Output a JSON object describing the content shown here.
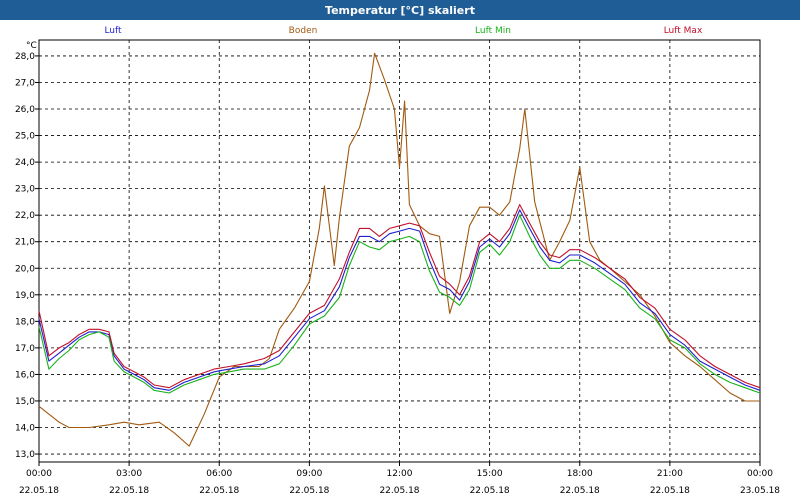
{
  "window": {
    "title": "Temperatur [°C] skaliert"
  },
  "colors": {
    "title_bar": "#1f5d96",
    "luft": "#1f1fd0",
    "boden": "#a05a10",
    "luft_min": "#19b219",
    "luft_max": "#c0102a"
  },
  "chart_data": {
    "type": "line",
    "title": "Temperatur [°C] skaliert",
    "xlabel": "",
    "ylabel": "°C",
    "y_unit_label": "°C",
    "ylim": [
      12.7,
      28.6
    ],
    "y_ticks": [
      "13,0",
      "14,0",
      "15,0",
      "16,0",
      "17,0",
      "18,0",
      "19,0",
      "20,0",
      "21,0",
      "22,0",
      "23,0",
      "24,0",
      "25,0",
      "26,0",
      "27,0",
      "28,0"
    ],
    "x_hours_range": [
      0,
      24
    ],
    "x_ticks": [
      {
        "time": "00:00",
        "date": "22.05.18"
      },
      {
        "time": "03:00",
        "date": "22.05.18"
      },
      {
        "time": "06:00",
        "date": "22.05.18"
      },
      {
        "time": "09:00",
        "date": "22.05.18"
      },
      {
        "time": "12:00",
        "date": "22.05.18"
      },
      {
        "time": "15:00",
        "date": "22.05.18"
      },
      {
        "time": "18:00",
        "date": "22.05.18"
      },
      {
        "time": "21:00",
        "date": "22.05.18"
      },
      {
        "time": "00:00",
        "date": "23.05.18"
      }
    ],
    "grid": true,
    "legend_position": "top",
    "series": [
      {
        "name": "Luft",
        "color": "#1f1fd0",
        "points": [
          [
            0,
            18.1
          ],
          [
            0.33,
            16.5
          ],
          [
            0.67,
            16.8
          ],
          [
            1.0,
            17.1
          ],
          [
            1.33,
            17.4
          ],
          [
            1.67,
            17.6
          ],
          [
            2.0,
            17.6
          ],
          [
            2.33,
            17.5
          ],
          [
            2.5,
            16.7
          ],
          [
            2.83,
            16.2
          ],
          [
            3.17,
            16.0
          ],
          [
            3.5,
            15.8
          ],
          [
            3.83,
            15.5
          ],
          [
            4.33,
            15.4
          ],
          [
            4.83,
            15.7
          ],
          [
            5.33,
            15.9
          ],
          [
            5.83,
            16.1
          ],
          [
            6.33,
            16.2
          ],
          [
            6.83,
            16.3
          ],
          [
            7.5,
            16.4
          ],
          [
            8.0,
            16.7
          ],
          [
            8.5,
            17.4
          ],
          [
            9.0,
            18.1
          ],
          [
            9.5,
            18.4
          ],
          [
            10.0,
            19.3
          ],
          [
            10.33,
            20.4
          ],
          [
            10.67,
            21.2
          ],
          [
            11.0,
            21.2
          ],
          [
            11.33,
            21.0
          ],
          [
            11.67,
            21.3
          ],
          [
            12.0,
            21.4
          ],
          [
            12.33,
            21.5
          ],
          [
            12.67,
            21.4
          ],
          [
            13.0,
            20.3
          ],
          [
            13.33,
            19.4
          ],
          [
            13.67,
            19.2
          ],
          [
            14.0,
            18.8
          ],
          [
            14.33,
            19.5
          ],
          [
            14.67,
            20.8
          ],
          [
            15.0,
            21.1
          ],
          [
            15.33,
            20.8
          ],
          [
            15.67,
            21.3
          ],
          [
            16.0,
            22.2
          ],
          [
            16.33,
            21.5
          ],
          [
            16.67,
            20.8
          ],
          [
            17.0,
            20.3
          ],
          [
            17.33,
            20.2
          ],
          [
            17.67,
            20.5
          ],
          [
            18.0,
            20.5
          ],
          [
            18.5,
            20.2
          ],
          [
            19.0,
            19.8
          ],
          [
            19.5,
            19.4
          ],
          [
            20.0,
            18.7
          ],
          [
            20.5,
            18.3
          ],
          [
            21.0,
            17.5
          ],
          [
            21.5,
            17.1
          ],
          [
            22.0,
            16.5
          ],
          [
            22.5,
            16.2
          ],
          [
            23.0,
            15.9
          ],
          [
            23.5,
            15.6
          ],
          [
            24.0,
            15.4
          ]
        ]
      },
      {
        "name": "Boden",
        "color": "#a05a10",
        "points": [
          [
            0,
            14.8
          ],
          [
            0.67,
            14.2
          ],
          [
            1.0,
            14.0
          ],
          [
            1.67,
            14.0
          ],
          [
            2.33,
            14.1
          ],
          [
            2.83,
            14.2
          ],
          [
            3.33,
            14.1
          ],
          [
            4.0,
            14.2
          ],
          [
            4.5,
            13.8
          ],
          [
            5.0,
            13.3
          ],
          [
            5.5,
            14.5
          ],
          [
            6.0,
            15.9
          ],
          [
            6.5,
            16.3
          ],
          [
            7.0,
            16.3
          ],
          [
            7.33,
            16.3
          ],
          [
            7.67,
            16.6
          ],
          [
            8.0,
            17.7
          ],
          [
            8.5,
            18.5
          ],
          [
            9.0,
            19.5
          ],
          [
            9.33,
            21.5
          ],
          [
            9.5,
            23.1
          ],
          [
            9.83,
            20.1
          ],
          [
            10.0,
            21.9
          ],
          [
            10.33,
            24.6
          ],
          [
            10.67,
            25.3
          ],
          [
            11.0,
            26.7
          ],
          [
            11.17,
            28.1
          ],
          [
            11.5,
            27.1
          ],
          [
            11.83,
            26.0
          ],
          [
            12.0,
            23.8
          ],
          [
            12.17,
            26.3
          ],
          [
            12.33,
            22.4
          ],
          [
            12.67,
            21.6
          ],
          [
            13.0,
            21.3
          ],
          [
            13.33,
            21.2
          ],
          [
            13.67,
            18.3
          ],
          [
            14.0,
            19.5
          ],
          [
            14.33,
            21.6
          ],
          [
            14.67,
            22.3
          ],
          [
            15.0,
            22.3
          ],
          [
            15.33,
            22.0
          ],
          [
            15.67,
            22.5
          ],
          [
            16.0,
            24.5
          ],
          [
            16.17,
            26.0
          ],
          [
            16.5,
            22.5
          ],
          [
            17.0,
            20.3
          ],
          [
            17.33,
            21.0
          ],
          [
            17.67,
            21.8
          ],
          [
            18.0,
            23.8
          ],
          [
            18.33,
            21.0
          ],
          [
            18.67,
            20.3
          ],
          [
            19.0,
            20.0
          ],
          [
            19.5,
            19.5
          ],
          [
            20.0,
            19.0
          ],
          [
            20.5,
            18.2
          ],
          [
            21.0,
            17.2
          ],
          [
            21.5,
            16.7
          ],
          [
            22.0,
            16.3
          ],
          [
            22.5,
            15.8
          ],
          [
            23.0,
            15.3
          ],
          [
            23.5,
            15.0
          ],
          [
            24.0,
            15.0
          ]
        ]
      },
      {
        "name": "Luft Min",
        "color": "#19b219",
        "points": [
          [
            0,
            17.8
          ],
          [
            0.33,
            16.2
          ],
          [
            0.67,
            16.6
          ],
          [
            1.0,
            16.9
          ],
          [
            1.33,
            17.3
          ],
          [
            1.67,
            17.5
          ],
          [
            2.0,
            17.6
          ],
          [
            2.33,
            17.4
          ],
          [
            2.5,
            16.5
          ],
          [
            2.83,
            16.1
          ],
          [
            3.17,
            15.9
          ],
          [
            3.5,
            15.7
          ],
          [
            3.83,
            15.4
          ],
          [
            4.33,
            15.3
          ],
          [
            4.83,
            15.6
          ],
          [
            5.33,
            15.8
          ],
          [
            5.83,
            16.0
          ],
          [
            6.33,
            16.1
          ],
          [
            6.83,
            16.2
          ],
          [
            7.5,
            16.2
          ],
          [
            8.0,
            16.4
          ],
          [
            8.5,
            17.1
          ],
          [
            9.0,
            17.9
          ],
          [
            9.5,
            18.2
          ],
          [
            10.0,
            18.9
          ],
          [
            10.33,
            20.1
          ],
          [
            10.67,
            21.0
          ],
          [
            11.0,
            20.8
          ],
          [
            11.33,
            20.7
          ],
          [
            11.67,
            21.0
          ],
          [
            12.0,
            21.1
          ],
          [
            12.33,
            21.2
          ],
          [
            12.67,
            21.0
          ],
          [
            13.0,
            19.9
          ],
          [
            13.33,
            19.1
          ],
          [
            13.67,
            18.9
          ],
          [
            14.0,
            18.6
          ],
          [
            14.33,
            19.2
          ],
          [
            14.67,
            20.6
          ],
          [
            15.0,
            20.9
          ],
          [
            15.33,
            20.5
          ],
          [
            15.67,
            21.0
          ],
          [
            16.0,
            22.0
          ],
          [
            16.33,
            21.2
          ],
          [
            16.67,
            20.5
          ],
          [
            17.0,
            20.0
          ],
          [
            17.33,
            20.0
          ],
          [
            17.67,
            20.3
          ],
          [
            18.0,
            20.3
          ],
          [
            18.5,
            20.0
          ],
          [
            19.0,
            19.6
          ],
          [
            19.5,
            19.2
          ],
          [
            20.0,
            18.5
          ],
          [
            20.5,
            18.1
          ],
          [
            21.0,
            17.3
          ],
          [
            21.5,
            17.0
          ],
          [
            22.0,
            16.4
          ],
          [
            22.5,
            16.0
          ],
          [
            23.0,
            15.7
          ],
          [
            23.5,
            15.5
          ],
          [
            24.0,
            15.3
          ]
        ]
      },
      {
        "name": "Luft Max",
        "color": "#c0102a",
        "points": [
          [
            0,
            18.4
          ],
          [
            0.33,
            16.7
          ],
          [
            0.67,
            17.0
          ],
          [
            1.0,
            17.2
          ],
          [
            1.33,
            17.5
          ],
          [
            1.67,
            17.7
          ],
          [
            2.0,
            17.7
          ],
          [
            2.33,
            17.6
          ],
          [
            2.5,
            16.8
          ],
          [
            2.83,
            16.3
          ],
          [
            3.17,
            16.1
          ],
          [
            3.5,
            15.9
          ],
          [
            3.83,
            15.6
          ],
          [
            4.33,
            15.5
          ],
          [
            4.83,
            15.8
          ],
          [
            5.33,
            16.0
          ],
          [
            5.83,
            16.2
          ],
          [
            6.33,
            16.3
          ],
          [
            6.83,
            16.4
          ],
          [
            7.5,
            16.6
          ],
          [
            8.0,
            16.9
          ],
          [
            8.5,
            17.6
          ],
          [
            9.0,
            18.3
          ],
          [
            9.5,
            18.6
          ],
          [
            10.0,
            19.6
          ],
          [
            10.33,
            20.6
          ],
          [
            10.67,
            21.5
          ],
          [
            11.0,
            21.5
          ],
          [
            11.33,
            21.2
          ],
          [
            11.67,
            21.5
          ],
          [
            12.0,
            21.6
          ],
          [
            12.33,
            21.7
          ],
          [
            12.67,
            21.6
          ],
          [
            13.0,
            20.6
          ],
          [
            13.33,
            19.7
          ],
          [
            13.67,
            19.4
          ],
          [
            14.0,
            19.0
          ],
          [
            14.33,
            19.7
          ],
          [
            14.67,
            21.0
          ],
          [
            15.0,
            21.3
          ],
          [
            15.33,
            21.0
          ],
          [
            15.67,
            21.5
          ],
          [
            16.0,
            22.4
          ],
          [
            16.33,
            21.7
          ],
          [
            16.67,
            21.0
          ],
          [
            17.0,
            20.5
          ],
          [
            17.33,
            20.4
          ],
          [
            17.67,
            20.7
          ],
          [
            18.0,
            20.7
          ],
          [
            18.5,
            20.4
          ],
          [
            19.0,
            20.0
          ],
          [
            19.5,
            19.6
          ],
          [
            20.0,
            18.9
          ],
          [
            20.5,
            18.5
          ],
          [
            21.0,
            17.7
          ],
          [
            21.5,
            17.3
          ],
          [
            22.0,
            16.7
          ],
          [
            22.5,
            16.3
          ],
          [
            23.0,
            16.0
          ],
          [
            23.5,
            15.7
          ],
          [
            24.0,
            15.5
          ]
        ]
      }
    ]
  }
}
